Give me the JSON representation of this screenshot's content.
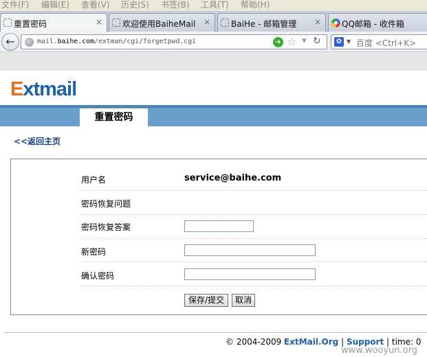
{
  "menubar": {
    "items": [
      "文件(F)",
      "编辑(E)",
      "查看(V)",
      "历史(S)",
      "书签(B)",
      "工具(T)",
      "帮助(H)"
    ]
  },
  "tabs": [
    {
      "title": "重置密码",
      "close": "×",
      "active": true
    },
    {
      "title": "欢迎使用BaiheMail",
      "close": "×",
      "active": false
    },
    {
      "title": "BaiHe - 邮箱管理",
      "close": "×",
      "active": false
    },
    {
      "title": "QQ邮箱 - 收件箱",
      "close": "×",
      "active": false
    }
  ],
  "navbar": {
    "url_prefix": "mail.",
    "url_domain": "baihe.com",
    "url_path": "/extman/cgi/forgetpwd.cgi",
    "search_placeholder": "百度 <Ctrl+K>",
    "back_icon": "back-arrow-icon",
    "go_icon": "go-arrow-icon",
    "star_icon": "bookmark-star-icon",
    "reload_icon": "reload-icon"
  },
  "logo": {
    "first": "E",
    "rest": "xtmail",
    "colors": {
      "first": "#e8701c",
      "rest": "#1f5fa8"
    }
  },
  "page_tab": "重置密码",
  "back_link": "<<返回主页",
  "form": {
    "username_label": "用户名",
    "username_value": "service@baihe.com",
    "question_label": "密码恢复问题",
    "question_value": "",
    "answer_label": "密码恢复答案",
    "answer_value": "",
    "new_password_label": "新密码",
    "new_password_value": "",
    "confirm_password_label": "确认密码",
    "confirm_password_value": "",
    "submit_label": "保存/提交",
    "cancel_label": "取消"
  },
  "footer": {
    "copyright": "© 2004-2009 ",
    "brand": "ExtMail.Org",
    "sep1": " | ",
    "support": "Support",
    "sep2": " | time: 0"
  },
  "watermark": "www.wooyun.org",
  "colors": {
    "band": "#6ca0cc",
    "band_top": "#4f86b8",
    "link": "#1c3f7d"
  }
}
